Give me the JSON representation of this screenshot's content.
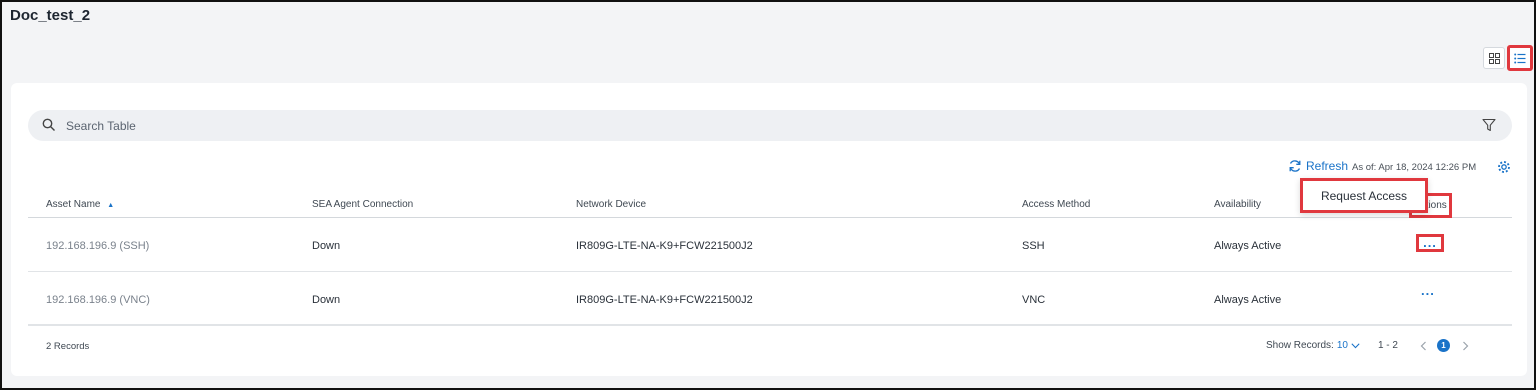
{
  "page": {
    "title": "Doc_test_2"
  },
  "search": {
    "placeholder": "Search Table"
  },
  "toolbar": {
    "refresh_label": "Refresh",
    "as_of": "As of: Apr 18, 2024 12:26 PM"
  },
  "table": {
    "columns": [
      "Asset Name",
      "SEA Agent Connection",
      "Network Device",
      "Access Method",
      "Availability",
      "Actions"
    ],
    "rows": [
      {
        "asset": "192.168.196.9 (SSH)",
        "connection": "Down",
        "device": "IR809G-LTE-NA-K9+FCW221500J2",
        "method": "SSH",
        "availability": "Always Active"
      },
      {
        "asset": "192.168.196.9 (VNC)",
        "connection": "Down",
        "device": "IR809G-LTE-NA-K9+FCW221500J2",
        "method": "VNC",
        "availability": "Always Active"
      }
    ],
    "actions_glyph": "...",
    "sort_indicator": "▲"
  },
  "popup": {
    "request_access": "Request Access"
  },
  "footer": {
    "records": "2 Records",
    "show_records_label": "Show Records:",
    "show_records_value": "10",
    "range": "1 - 2",
    "current_page": "1"
  },
  "colors": {
    "accent": "#1a73c8",
    "highlight": "#e0383e"
  }
}
